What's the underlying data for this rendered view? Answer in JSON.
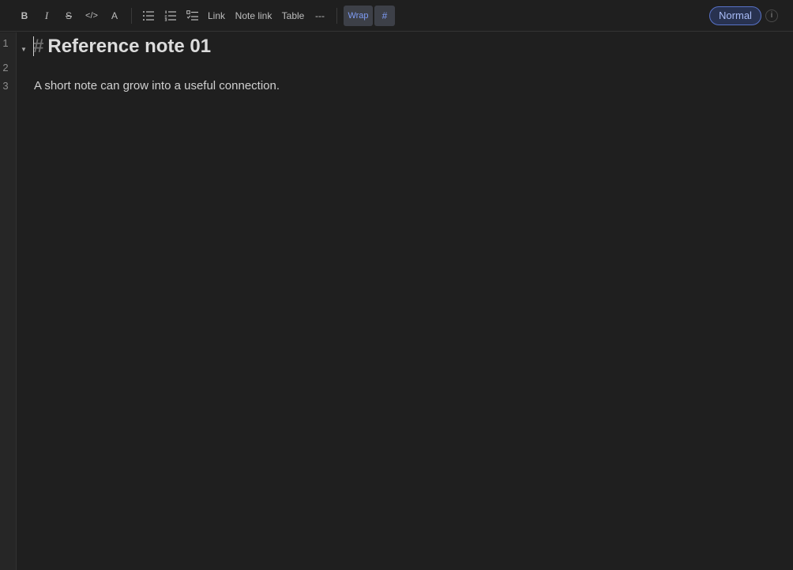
{
  "toolbar": {
    "bold_label": "B",
    "italic_label": "I",
    "strike_label": "S",
    "code_label": "</>",
    "color_label": "A",
    "link_label": "Link",
    "note_link_label": "Note link",
    "table_label": "Table",
    "hr_label": "---",
    "wrap_label": "Wrap",
    "heading_toggle_label": "#",
    "mode_label": "Normal",
    "info_label": "i"
  },
  "editor": {
    "line_numbers": [
      "1",
      "2",
      "3"
    ],
    "fold_glyph": "▼",
    "heading_mark": "#",
    "heading_text": "Reference note 01",
    "body_text": "A short note can grow into a useful connection."
  },
  "colors": {
    "accent": "#7f9cf5",
    "background": "#1f1f1f"
  }
}
